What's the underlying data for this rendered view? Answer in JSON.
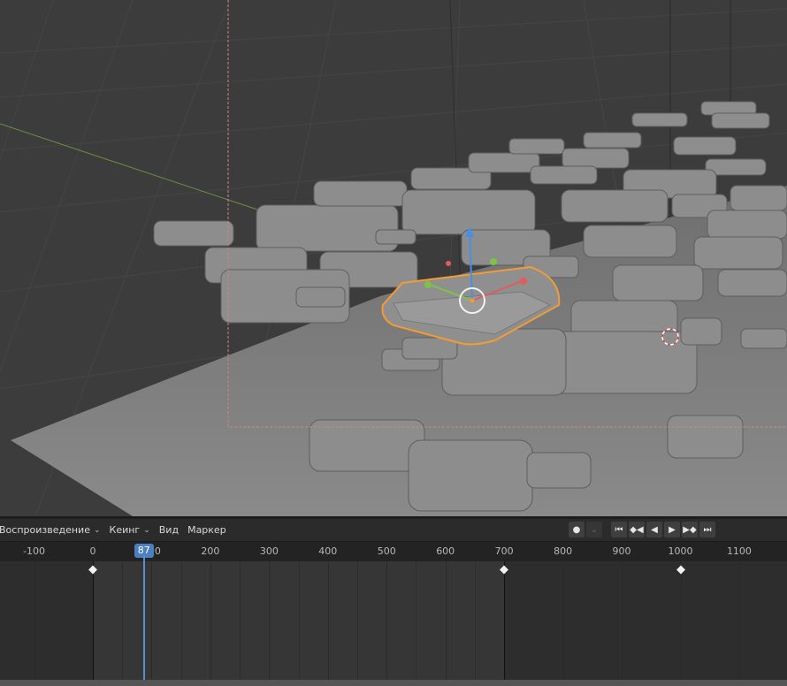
{
  "timeline": {
    "menus": [
      {
        "label": "Воспроизведение",
        "dropdown": true
      },
      {
        "label": "Кеинг",
        "dropdown": true
      },
      {
        "label": "Вид",
        "dropdown": false
      },
      {
        "label": "Маркер",
        "dropdown": false
      }
    ],
    "playback_icons": [
      "record-icon",
      "chevron-down-icon",
      "jump-start-icon",
      "prev-keyframe-icon",
      "play-reverse-icon",
      "play-icon",
      "next-keyframe-icon",
      "jump-end-icon"
    ],
    "ruler_labels": [
      "-100",
      "0",
      "100",
      "200",
      "300",
      "400",
      "500",
      "600",
      "700",
      "800",
      "900",
      "1000",
      "1100"
    ],
    "current_frame": "87",
    "keyframes": [
      0,
      700,
      1000
    ]
  },
  "viewport": {
    "selection_color": "#f39c33",
    "gizmo_colors": {
      "x": "#e35b5b",
      "y": "#7ec24a",
      "z": "#4a8fe6"
    },
    "playhead_color": "#5b8ed1"
  }
}
